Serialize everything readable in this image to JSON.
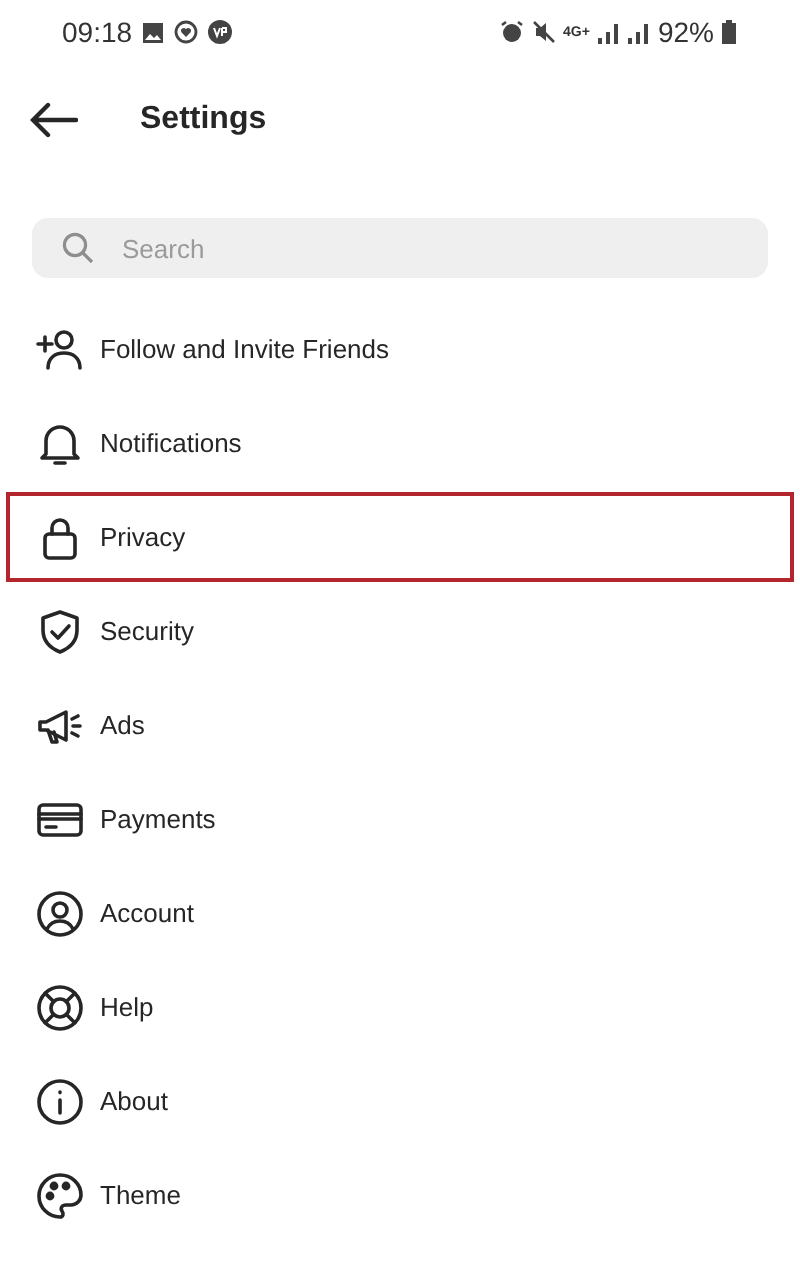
{
  "status_bar": {
    "time": "09:18",
    "network": "4G+",
    "battery": "92%"
  },
  "header": {
    "title": "Settings"
  },
  "search": {
    "placeholder": "Search"
  },
  "items": [
    {
      "label": "Follow and Invite Friends",
      "kind": "follow",
      "selected": false
    },
    {
      "label": "Notifications",
      "kind": "bell",
      "selected": false
    },
    {
      "label": "Privacy",
      "kind": "lock",
      "selected": true
    },
    {
      "label": "Security",
      "kind": "shield",
      "selected": false
    },
    {
      "label": "Ads",
      "kind": "megaphone",
      "selected": false
    },
    {
      "label": "Payments",
      "kind": "card",
      "selected": false
    },
    {
      "label": "Account",
      "kind": "person",
      "selected": false
    },
    {
      "label": "Help",
      "kind": "lifebuoy",
      "selected": false
    },
    {
      "label": "About",
      "kind": "info",
      "selected": false
    },
    {
      "label": "Theme",
      "kind": "palette",
      "selected": false
    }
  ]
}
